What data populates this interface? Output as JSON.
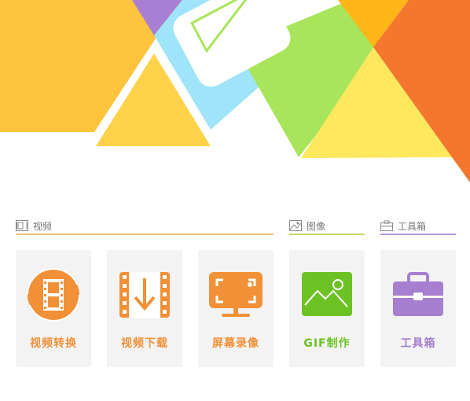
{
  "sections": {
    "video": {
      "title": "视频",
      "color": "#f5c074",
      "icon": "film-icon"
    },
    "image": {
      "title": "图像",
      "color": "#c9d86a",
      "icon": "image-icon"
    },
    "toolbox": {
      "title": "工具箱",
      "color": "#b593d6",
      "icon": "toolbox-icon"
    }
  },
  "tools": [
    {
      "label": "视频转换",
      "color": "#f29037",
      "icon": "video-convert-icon"
    },
    {
      "label": "视频下载",
      "color": "#f29037",
      "icon": "video-download-icon"
    },
    {
      "label": "屏幕录像",
      "color": "#f29037",
      "icon": "screen-record-icon"
    },
    {
      "label": "GIF制作",
      "color": "#6cc224",
      "icon": "gif-maker-icon"
    },
    {
      "label": "工具箱",
      "color": "#a67fd0",
      "icon": "toolbox-icon"
    }
  ]
}
